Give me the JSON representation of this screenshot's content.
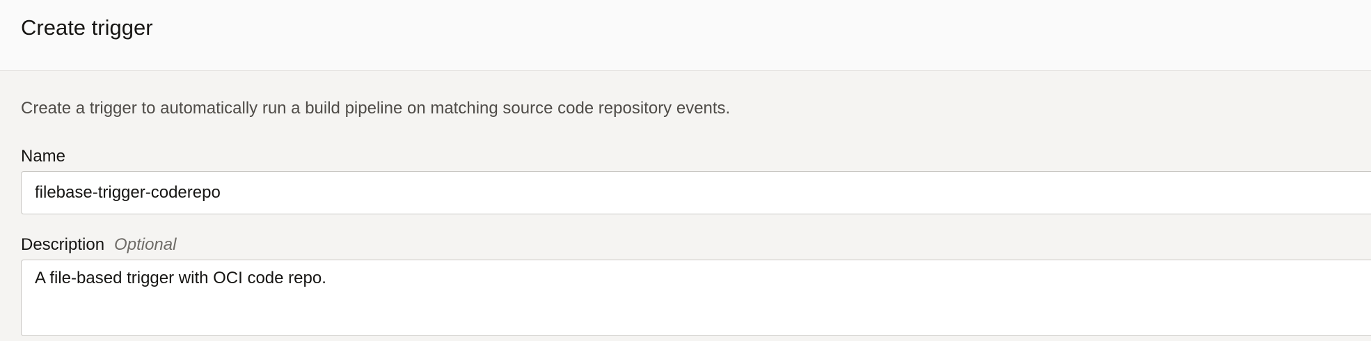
{
  "header": {
    "title": "Create trigger"
  },
  "form": {
    "intro": "Create a trigger to automatically run a build pipeline on matching source code repository events.",
    "name": {
      "label": "Name",
      "value": "filebase-trigger-coderepo"
    },
    "description": {
      "label": "Description",
      "optional_label": "Optional",
      "value": "A file-based trigger with OCI code repo."
    }
  }
}
